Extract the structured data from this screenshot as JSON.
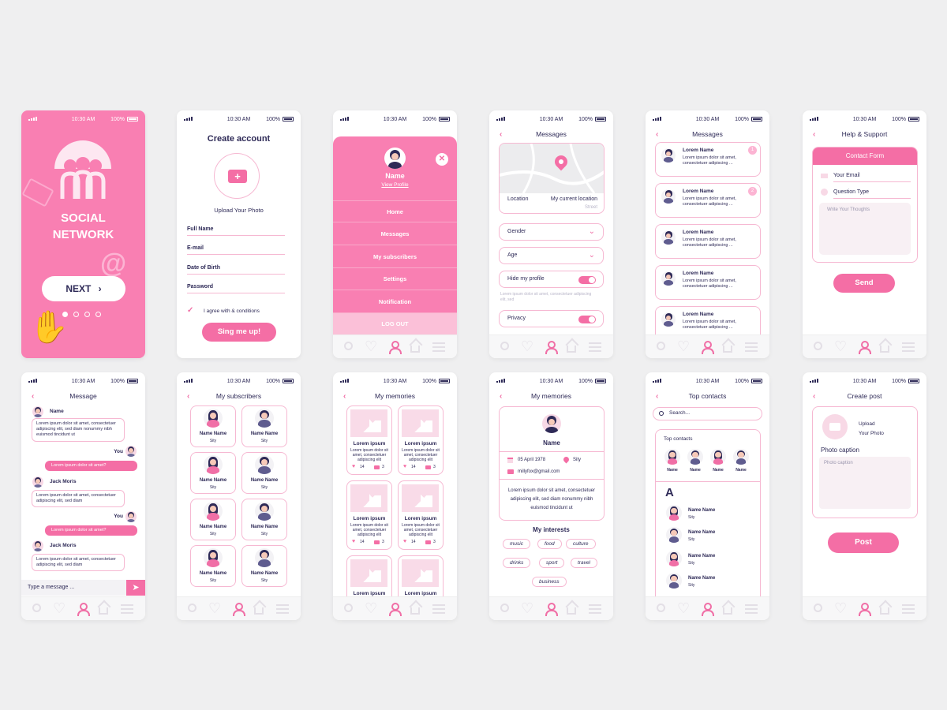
{
  "status_bar": {
    "time": "10:30 AM",
    "battery": "100%"
  },
  "screen1": {
    "title_line1": "SOCIAL",
    "title_line2": "NETWORK",
    "next_label": "NEXT"
  },
  "screen2": {
    "title": "Create account",
    "upload_label": "Upload Your Photo",
    "fields": [
      "Full Name",
      "E-mail",
      "Date of Birth",
      "Password"
    ],
    "agree_label": "I agree with & conditions",
    "submit_label": "Sing me up!"
  },
  "screen3": {
    "name": "Name",
    "view_profile": "View Profile",
    "menu": [
      "Home",
      "Messages",
      "My subscribers",
      "Settings",
      "Notification"
    ],
    "logout": "LOG OUT"
  },
  "screen4": {
    "title": "Messages",
    "location_label": "Location",
    "current_location": "My current location",
    "street": "Street",
    "gender": "Gender",
    "age": "Age",
    "hide_profile": "Hide my profile",
    "lorem_note": "Lorem ipsum dolor sit amet, consectetuer adipiscing elit, sed",
    "privacy": "Privacy"
  },
  "screen5": {
    "title": "Messages",
    "items": [
      {
        "name": "Lorem Name",
        "text": "Lorem ipsum dolor sit amet, consectetuer adipiscing ...",
        "badge": "1"
      },
      {
        "name": "Lorem Name",
        "text": "Lorem ipsum dolor sit amet, consectetuer adipiscing ...",
        "badge": "2"
      },
      {
        "name": "Lorem Name",
        "text": "Lorem ipsum dolor sit amet, consectetuer adipiscing ...",
        "badge": ""
      },
      {
        "name": "Lorem Name",
        "text": "Lorem ipsum dolor sit amet, consectetuer adipiscing ...",
        "badge": ""
      },
      {
        "name": "Lorem Name",
        "text": "Lorem ipsum dolor sit amet, consectetuer adipiscing ...",
        "badge": ""
      }
    ]
  },
  "screen6": {
    "title": "Help & Support",
    "form_title": "Contact Form",
    "email": "Your Email",
    "question": "Question Type",
    "thoughts": "Write Your Thoughts",
    "send": "Send"
  },
  "screen7": {
    "title": "Message",
    "name1": "Name",
    "msg1": "Lorem ipsum dolor sit amet, consectetuer adipiscing elit, sed diam nonummy nibh euismod tincidunt ut",
    "you": "You",
    "mymsg": "Lorem ipsum dolor sit amet?",
    "name2": "Jack Moris",
    "msg2": "Lorem ipsum dolor sit amet, consectetuer adipiscing elit, sed diam",
    "name3": "Jack Moris",
    "msg3": "Lorem ipsum dolor sit amet, consectetuer adipiscing elit, sed diam",
    "type_placeholder": "Type a message ..."
  },
  "screen8": {
    "title": "My subscribers",
    "name": "Name Name",
    "city": "Sity"
  },
  "screen9": {
    "title": "My memories",
    "caption": "Lorem ipsum",
    "text": "Lorem ipsum dolor sit amet, consectetuer adipiscing elit",
    "likes": "14",
    "comments": "3"
  },
  "screen10": {
    "title": "My memories",
    "name": "Name",
    "date": "05 April 1978",
    "city": "Sity",
    "email": "millyfox@gmail.com",
    "bio": "Lorem ipsum dolor sit amet, consectetuer adipiscing elit, sed diam nonummy nibh euismod tincidunt ut",
    "interests_title": "My interests",
    "tags": [
      "music",
      "food",
      "culture",
      "drinks",
      "sport",
      "travel",
      "business"
    ]
  },
  "screen11": {
    "title": "Top contacts",
    "search": "Search...",
    "section": "Top contacts",
    "top_name": "Name",
    "letter": "A",
    "contact_name": "Name Name",
    "contact_city": "Sity"
  },
  "screen12": {
    "title": "Create post",
    "upload1": "Upload",
    "upload2": "Your Photo",
    "caption_title": "Photo caption",
    "caption_placeholder": "Photo caption",
    "post": "Post"
  },
  "colors": {
    "pink": "#f46ea5",
    "light_pink": "#f6b8d2",
    "navy": "#2e2a57",
    "background": "#efeff0"
  }
}
